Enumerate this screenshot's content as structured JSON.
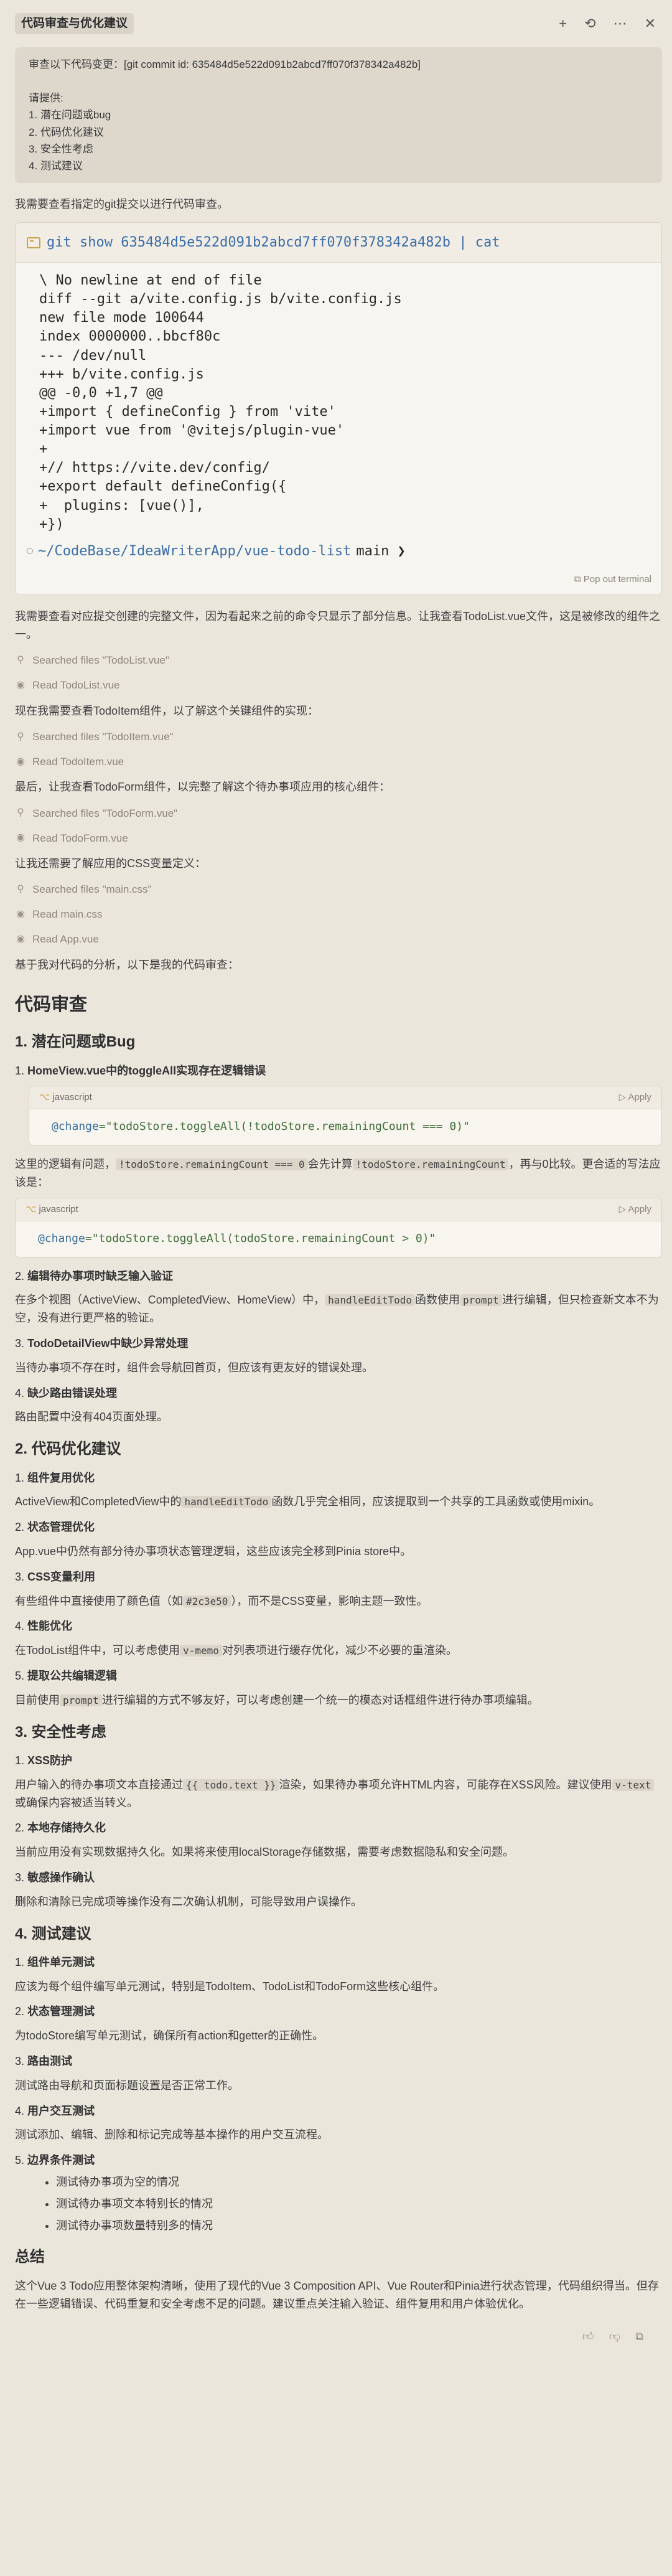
{
  "header": {
    "title": "代码审查与优化建议",
    "icons": [
      "plus-icon",
      "history-icon",
      "more-icon",
      "close-icon"
    ]
  },
  "user_message": {
    "lines": [
      "审查以下代码变更：[git commit id: 635484d5e522d091b2abcd7ff070f378342a482b]",
      "",
      "请提供:",
      "1. 潜在问题或bug",
      "2. 代码优化建议",
      "3. 安全性考虑",
      "4. 测试建议"
    ]
  },
  "intro_text": "我需要查看指定的git提交以进行代码审查。",
  "terminal": {
    "command": "git show 635484d5e522d091b2abcd7ff070f378342a482b | cat",
    "output": "\\ No newline at end of file\ndiff --git a/vite.config.js b/vite.config.js\nnew file mode 100644\nindex 0000000..bbcf80c\n--- /dev/null\n+++ b/vite.config.js\n@@ -0,0 +1,7 @@\n+import { defineConfig } from 'vite'\n+import vue from '@vitejs/plugin-vue'\n+\n+// https://vite.dev/config/\n+export default defineConfig({\n+  plugins: [vue()],\n+})",
    "prompt_path": "~/CodeBase/IdeaWriterApp/vue-todo-list",
    "prompt_branch": "main ❯",
    "popout_label": "Pop out terminal"
  },
  "after_terminal_text": "我需要查看对应提交创建的完整文件，因为看起来之前的命令只显示了部分信息。让我查看TodoList.vue文件，这是被修改的组件之一。",
  "tool_steps_1": [
    {
      "icon": "search-icon",
      "glyph": "⚲",
      "label": "Searched files \"TodoList.vue\""
    },
    {
      "icon": "eye-icon",
      "glyph": "◉",
      "label": "Read TodoList.vue"
    }
  ],
  "text_2": "现在我需要查看TodoItem组件，以了解这个关键组件的实现：",
  "tool_steps_2": [
    {
      "icon": "search-icon",
      "glyph": "⚲",
      "label": "Searched files \"TodoItem.vue\""
    },
    {
      "icon": "eye-icon",
      "glyph": "◉",
      "label": "Read TodoItem.vue"
    }
  ],
  "text_3": "最后，让我查看TodoForm组件，以完整了解这个待办事项应用的核心组件：",
  "tool_steps_3": [
    {
      "icon": "search-icon",
      "glyph": "⚲",
      "label": "Searched files \"TodoForm.vue\""
    },
    {
      "icon": "eye-icon",
      "glyph": "◉",
      "label": "Read TodoForm.vue"
    }
  ],
  "text_4": "让我还需要了解应用的CSS变量定义：",
  "tool_steps_4": [
    {
      "icon": "search-icon",
      "glyph": "⚲",
      "label": "Searched files \"main.css\""
    },
    {
      "icon": "eye-icon",
      "glyph": "◉",
      "label": "Read main.css"
    },
    {
      "icon": "eye-icon",
      "glyph": "◉",
      "label": "Read App.vue"
    }
  ],
  "text_5": "基于我对代码的分析，以下是我的代码审查：",
  "review": {
    "heading": "代码审查",
    "s1": {
      "heading": "1. 潜在问题或Bug",
      "i1_num": "1.",
      "i1_title": "HomeView.vue中的toggleAll实现存在逻辑错误",
      "code1_lang": "javascript",
      "code1_apply": "Apply",
      "code1_attr": "@change",
      "code1_val": "=\"todoStore.toggleAll(!todoStore.remainingCount === 0)\"",
      "i1_desc_a": "这里的逻辑有问题，",
      "i1_code_a": "!todoStore.remainingCount === 0",
      "i1_desc_b": "会先计算",
      "i1_code_b": "!todoStore.remainingCount",
      "i1_desc_c": "，再与0比较。更合适的写法应该是：",
      "code2_lang": "javascript",
      "code2_apply": "Apply",
      "code2_attr": "@change",
      "code2_val": "=\"todoStore.toggleAll(todoStore.remainingCount > 0)\"",
      "i2_num": "2.",
      "i2_title": "编辑待办事项时缺乏输入验证",
      "i2_desc_a": "在多个视图（ActiveView、CompletedView、HomeView）中，",
      "i2_code_a": "handleEditTodo",
      "i2_desc_b": "函数使用",
      "i2_code_b": "prompt",
      "i2_desc_c": "进行编辑，但只检查新文本不为空，没有进行更严格的验证。",
      "i3_num": "3.",
      "i3_title": "TodoDetailView中缺少异常处理",
      "i3_desc": "当待办事项不存在时，组件会导航回首页，但应该有更友好的错误处理。",
      "i4_num": "4.",
      "i4_title": "缺少路由错误处理",
      "i4_desc": "路由配置中没有404页面处理。"
    },
    "s2": {
      "heading": "2. 代码优化建议",
      "i1_num": "1.",
      "i1_title": "组件复用优化",
      "i1_desc_a": "ActiveView和CompletedView中的",
      "i1_code": "handleEditTodo",
      "i1_desc_b": "函数几乎完全相同，应该提取到一个共享的工具函数或使用mixin。",
      "i2_num": "2.",
      "i2_title": "状态管理优化",
      "i2_desc": "App.vue中仍然有部分待办事项状态管理逻辑，这些应该完全移到Pinia store中。",
      "i3_num": "3.",
      "i3_title": "CSS变量利用",
      "i3_desc_a": "有些组件中直接使用了颜色值（如",
      "i3_code": "#2c3e50",
      "i3_desc_b": "），而不是CSS变量，影响主题一致性。",
      "i4_num": "4.",
      "i4_title": "性能优化",
      "i4_desc_a": "在TodoList组件中，可以考虑使用",
      "i4_code": "v-memo",
      "i4_desc_b": "对列表项进行缓存优化，减少不必要的重渲染。",
      "i5_num": "5.",
      "i5_title": "提取公共编辑逻辑",
      "i5_desc_a": "目前使用",
      "i5_code": "prompt",
      "i5_desc_b": "进行编辑的方式不够友好，可以考虑创建一个统一的模态对话框组件进行待办事项编辑。"
    },
    "s3": {
      "heading": "3. 安全性考虑",
      "i1_num": "1.",
      "i1_title": "XSS防护",
      "i1_desc_a": "用户输入的待办事项文本直接通过",
      "i1_code_a": "{{ todo.text }}",
      "i1_desc_b": "渲染，如果待办事项允许HTML内容，可能存在XSS风险。建议使用",
      "i1_code_b": "v-text",
      "i1_desc_c": "或确保内容被适当转义。",
      "i2_num": "2.",
      "i2_title": "本地存储持久化",
      "i2_desc": "当前应用没有实现数据持久化。如果将来使用localStorage存储数据，需要考虑数据隐私和安全问题。",
      "i3_num": "3.",
      "i3_title": "敏感操作确认",
      "i3_desc": "删除和清除已完成项等操作没有二次确认机制，可能导致用户误操作。"
    },
    "s4": {
      "heading": "4. 测试建议",
      "i1_num": "1.",
      "i1_title": "组件单元测试",
      "i1_desc": "应该为每个组件编写单元测试，特别是TodoItem、TodoList和TodoForm这些核心组件。",
      "i2_num": "2.",
      "i2_title": "状态管理测试",
      "i2_desc": "为todoStore编写单元测试，确保所有action和getter的正确性。",
      "i3_num": "3.",
      "i3_title": "路由测试",
      "i3_desc": "测试路由导航和页面标题设置是否正常工作。",
      "i4_num": "4.",
      "i4_title": "用户交互测试",
      "i4_desc": "测试添加、编辑、删除和标记完成等基本操作的用户交互流程。",
      "i5_num": "5.",
      "i5_title": "边界条件测试",
      "bullets": [
        "测试待办事项为空的情况",
        "测试待办事项文本特别长的情况",
        "测试待办事项数量特别多的情况"
      ]
    },
    "summary_heading": "总结",
    "summary_text": "这个Vue 3 Todo应用整体架构清晰，使用了现代的Vue 3 Composition API、Vue Router和Pinia进行状态管理，代码组织得当。但存在一些逻辑错误、代码重复和安全考虑不足的问题。建议重点关注输入验证、组件复用和用户体验优化。"
  },
  "footer_icons": [
    "thumbs-up-icon",
    "thumbs-down-icon",
    "copy-icon"
  ]
}
